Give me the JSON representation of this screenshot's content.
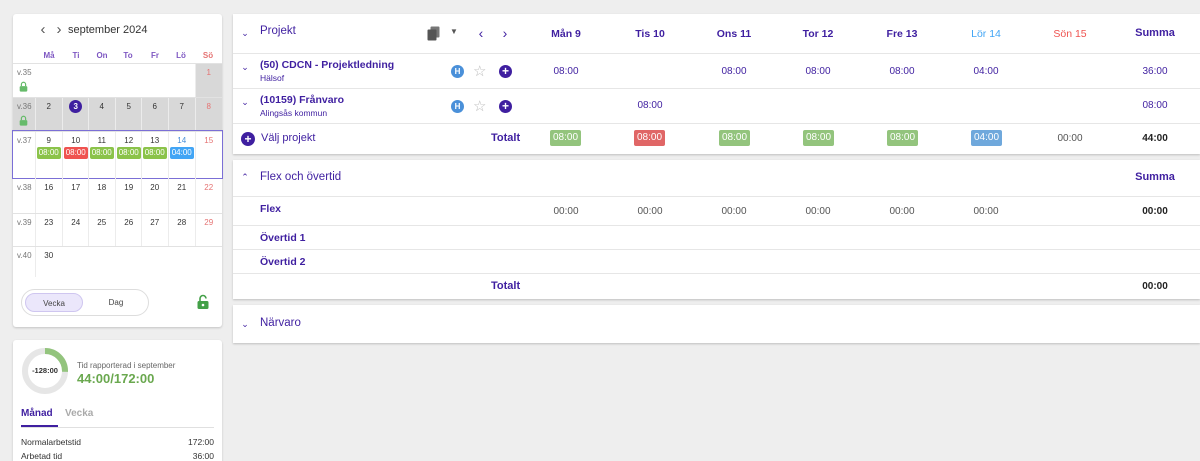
{
  "calendar": {
    "month_label": "september 2024",
    "weekdays": [
      "Må",
      "Ti",
      "On",
      "To",
      "Fr",
      "Lö",
      "Sö"
    ],
    "weeks": [
      {
        "label": "v.35",
        "days": [
          "",
          "",
          "",
          "",
          "",
          "",
          "1"
        ],
        "locked": true
      },
      {
        "label": "v.36",
        "days": [
          "2",
          "3",
          "4",
          "5",
          "6",
          "7",
          "8"
        ],
        "locked": true
      },
      {
        "label": "v.37",
        "days": [
          "9",
          "10",
          "11",
          "12",
          "13",
          "14",
          "15"
        ],
        "locked": false,
        "chips": [
          "08:00",
          "08:00",
          "08:00",
          "08:00",
          "08:00",
          "04:00",
          ""
        ]
      },
      {
        "label": "v.38",
        "days": [
          "16",
          "17",
          "18",
          "19",
          "20",
          "21",
          "22"
        ],
        "locked": false
      },
      {
        "label": "v.39",
        "days": [
          "23",
          "24",
          "25",
          "26",
          "27",
          "28",
          "29"
        ],
        "locked": false
      },
      {
        "label": "v.40",
        "days": [
          "30",
          "",
          "",
          "",
          "",
          "",
          ""
        ],
        "locked": false
      }
    ],
    "view_toggle": {
      "week": "Vecka",
      "day": "Dag"
    }
  },
  "summary": {
    "donut_value": "-128:00",
    "donut_fraction": 0.256,
    "subtitle": "Tid rapporterad i september",
    "reported": "44:00/172:00",
    "tabs": {
      "month": "Månad",
      "week": "Vecka"
    },
    "rows": [
      {
        "label": "Normalarbetstid",
        "value": "172:00"
      },
      {
        "label": "Arbetad tid",
        "value": "36:00"
      }
    ]
  },
  "projects": {
    "title": "Projekt",
    "days": [
      "Mån 9",
      "Tis 10",
      "Ons 11",
      "Tor 12",
      "Fre 13",
      "Lör 14",
      "Sön 15"
    ],
    "sum_label": "Summa",
    "rows": [
      {
        "name": "(50) CDCN - Projektledning",
        "client": "Hälsof",
        "badge": "H",
        "values": [
          "08:00",
          "",
          "08:00",
          "08:00",
          "08:00",
          "04:00",
          ""
        ],
        "sum": "36:00"
      },
      {
        "name": "(10159) Frånvaro",
        "client": "Alingsås kommun",
        "badge": "H",
        "values": [
          "",
          "08:00",
          "",
          "",
          "",
          "",
          ""
        ],
        "sum": "08:00"
      }
    ],
    "choose_label": "Välj projekt",
    "total_label": "Totalt",
    "totals": [
      "08:00",
      "08:00",
      "08:00",
      "08:00",
      "08:00",
      "04:00",
      "00:00"
    ],
    "total_sum": "44:00"
  },
  "flex": {
    "title": "Flex och övertid",
    "sum_label": "Summa",
    "rows": [
      {
        "label": "Flex",
        "values": [
          "00:00",
          "00:00",
          "00:00",
          "00:00",
          "00:00",
          "00:00",
          ""
        ],
        "sum": "00:00"
      },
      {
        "label": "Övertid 1",
        "values": [
          "",
          "",
          "",
          "",
          "",
          "",
          ""
        ],
        "sum": ""
      },
      {
        "label": "Övertid 2",
        "values": [
          "",
          "",
          "",
          "",
          "",
          "",
          ""
        ],
        "sum": ""
      }
    ],
    "total_label": "Totalt",
    "total_sum": "00:00"
  },
  "presence": {
    "title": "Närvaro"
  },
  "colors": {
    "primary": "#3f1fa0",
    "green": "#93c47d",
    "red": "#e06666",
    "blue": "#6fa8dc"
  }
}
